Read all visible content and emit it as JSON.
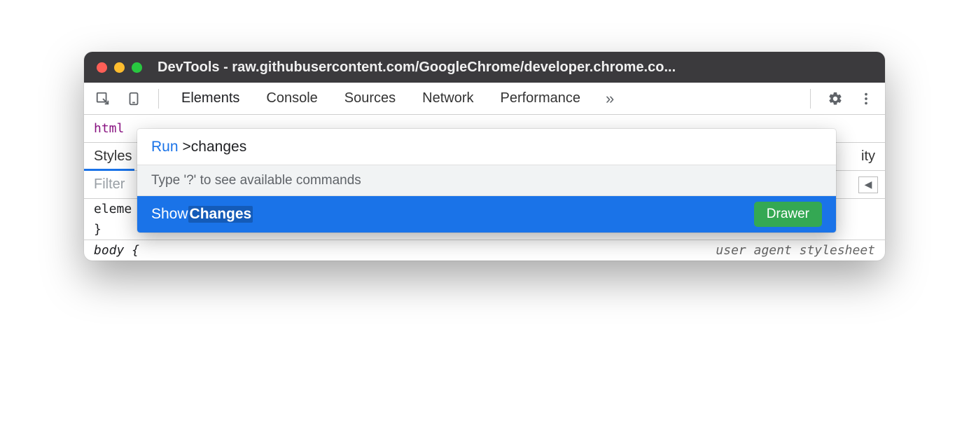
{
  "window": {
    "title": "DevTools - raw.githubusercontent.com/GoogleChrome/developer.chrome.co..."
  },
  "toolbar": {
    "tabs": [
      "Elements",
      "Console",
      "Sources",
      "Network",
      "Performance"
    ],
    "active_tab": "Elements"
  },
  "content": {
    "html_tag": "html",
    "styles_label": "Styles",
    "accessibility_fragment": "ity",
    "filter_placeholder": "Filter",
    "code_line_1": "eleme",
    "code_line_2": "}",
    "body_rule": "body {",
    "user_agent": "user agent stylesheet"
  },
  "command_menu": {
    "run_label": "Run",
    "query": ">changes",
    "hint": "Type '?' to see available commands",
    "result_prefix": "Show ",
    "result_match": "Changes",
    "badge": "Drawer"
  }
}
